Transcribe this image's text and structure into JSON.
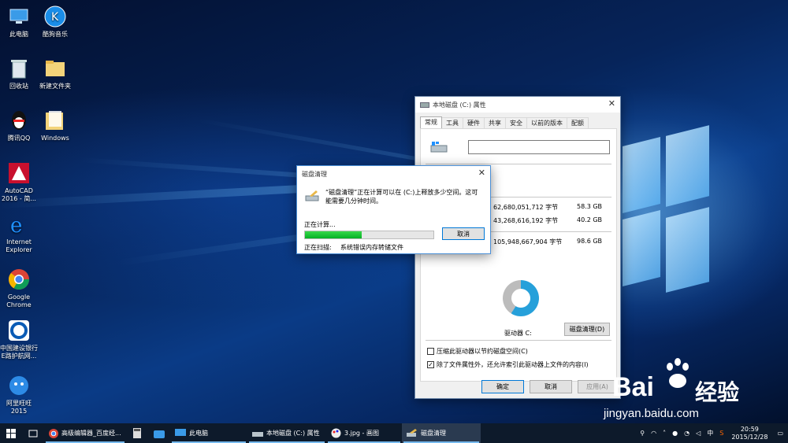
{
  "desktop_icons": [
    {
      "label": "此电脑",
      "icon": "computer-icon"
    },
    {
      "label": "酷狗音乐",
      "icon": "kugou-icon"
    },
    {
      "label": "回收站",
      "icon": "recycle-bin-icon"
    },
    {
      "label": "新建文件夹",
      "icon": "folder-icon"
    },
    {
      "label": "腾讯QQ",
      "icon": "qq-icon"
    },
    {
      "label": "Windows",
      "icon": "folder-icon"
    },
    {
      "label": "AutoCAD 2016 - 简...",
      "icon": "autocad-icon"
    },
    {
      "label": "Internet Explorer",
      "icon": "ie-icon"
    },
    {
      "label": "Google Chrome",
      "icon": "chrome-icon"
    },
    {
      "label": "中国建设银行E路护航网...",
      "icon": "ccb-icon"
    },
    {
      "label": "阿里旺旺2015",
      "icon": "aliwangwang-icon"
    }
  ],
  "properties_window": {
    "title": "本地磁盘 (C:) 属性",
    "tabs": [
      "常规",
      "工具",
      "硬件",
      "共享",
      "安全",
      "以前的版本",
      "配额"
    ],
    "active_tab": "常规",
    "rows": [
      {
        "bytes": "62,680,051,712 字节",
        "gb": "58.3 GB"
      },
      {
        "bytes": "43,268,616,192 字节",
        "gb": "40.2 GB"
      },
      {
        "bytes": "105,948,667,904 字节",
        "gb": "98.6 GB"
      }
    ],
    "used_fraction": 0.59,
    "drive_label": "驱动器 C:",
    "cleanup_button": "磁盘清理(D)",
    "compress_label": "压缩此驱动器以节约磁盘空间(C)",
    "compress_checked": false,
    "index_label": "除了文件属性外，还允许索引此驱动器上文件的内容(I)",
    "index_checked": true,
    "ok": "确定",
    "cancel": "取消",
    "apply": "应用(A)"
  },
  "cleanup_dialog": {
    "title": "磁盘清理",
    "message": "“磁盘清理”正在计算可以在 (C:)上释放多少空间。这可能需要几分钟时间。",
    "status": "正在计算...",
    "cancel": "取消",
    "progress": 0.44,
    "scan_label": "正在扫描:",
    "scan_item": "系统错误内存转储文件"
  },
  "taskbar": {
    "apps": [
      {
        "label": "高级编辑器_百度经...",
        "icon": "chrome-icon",
        "state": "run"
      },
      {
        "label": "",
        "icon": "calculator-icon",
        "state": "pinned"
      },
      {
        "label": "",
        "icon": "store-icon",
        "state": "pinned"
      },
      {
        "label": "此电脑",
        "icon": "computer-icon",
        "state": "run"
      },
      {
        "label": "本地磁盘 (C:) 属性",
        "icon": "drive-icon",
        "state": "run"
      },
      {
        "label": "3.jpg - 画图",
        "icon": "paint-icon",
        "state": "run"
      },
      {
        "label": "磁盘清理",
        "icon": "cleanup-icon",
        "state": "active"
      }
    ],
    "ime": "中",
    "time": "20:59",
    "date": "2015/12/28"
  },
  "watermark": {
    "brand": "Bai",
    "brand2": "经验",
    "url": "jingyan.baidu.com"
  }
}
